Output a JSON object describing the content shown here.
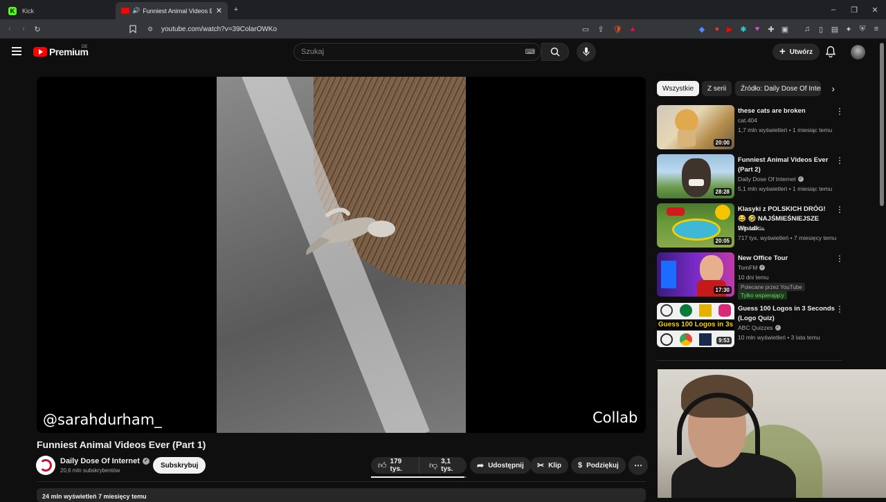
{
  "browser": {
    "tabs": [
      {
        "label": "Kick"
      },
      {
        "label": "Funniest Animal Videos Ever"
      }
    ],
    "url": "youtube.com/watch?v=39ColarOWKo"
  },
  "yt": {
    "logo_text": "Premium",
    "logo_region": "DE",
    "search_placeholder": "Szukaj",
    "create_label": "Utwórz"
  },
  "video": {
    "overlay_left": "@sarahdurham_",
    "overlay_right": "Collab",
    "title": "Funniest Animal Videos Ever (Part 1)",
    "channel": "Daily Dose Of Internet",
    "subscribers": "20,6 mln subskrybentów",
    "subscribe_label": "Subskrybuj",
    "likes": "179 tys.",
    "dislikes": "3,1 tys.",
    "share_label": "Udostępnij",
    "clip_label": "Klip",
    "thanks_label": "Podziękuj",
    "description_peek": "24 mln wyświetleń  7 miesięcy temu"
  },
  "sidebar": {
    "chips": [
      "Wszystkie",
      "Z serii",
      "Źródło: Daily Dose Of Internet"
    ],
    "items": [
      {
        "title": "these cats are broken",
        "channel": "cat.404",
        "verified": false,
        "stats": "1,7 mln wyświetleń • 1 miesiąc temu",
        "duration": "20:00",
        "title_lines": 1
      },
      {
        "title": "Funniest Animal Videos Ever (Part 2)",
        "channel": "Daily Dose Of Internet",
        "verified": true,
        "stats": "5,1 mln wyświetleń • 1 miesiąc temu",
        "duration": "28:28",
        "title_lines": 2
      },
      {
        "title": "Klasyki z POLSKICH DRÓG! 😂 🤣 NAJŚMIEŚNIEJSZE Wpadk...",
        "channel": "EduJazda",
        "verified": false,
        "stats": "717 tys. wyświetleń • 7 miesięcy temu",
        "duration": "20:05",
        "title_lines": 2
      },
      {
        "title": "New Office Tour",
        "channel": "TomFM",
        "verified": true,
        "stats": "10 dni temu",
        "duration": "17:30",
        "title_lines": 1,
        "badge": "Polecane przez YouTube",
        "badge2": "Tylko wspierający"
      },
      {
        "title": "Guess 100 Logos in 3 Seconds (Logo Quiz)",
        "channel": "ABC Quizzes",
        "verified": true,
        "stats": "10 mln wyświetleń • 3 lata temu",
        "duration": "9:53",
        "title_lines": 2,
        "thumb_text": "Guess 100 Logos in 3s"
      }
    ]
  },
  "colors": {
    "brand_red": "#ff0000",
    "bg": "#0f0f0f",
    "chip": "#272727"
  }
}
